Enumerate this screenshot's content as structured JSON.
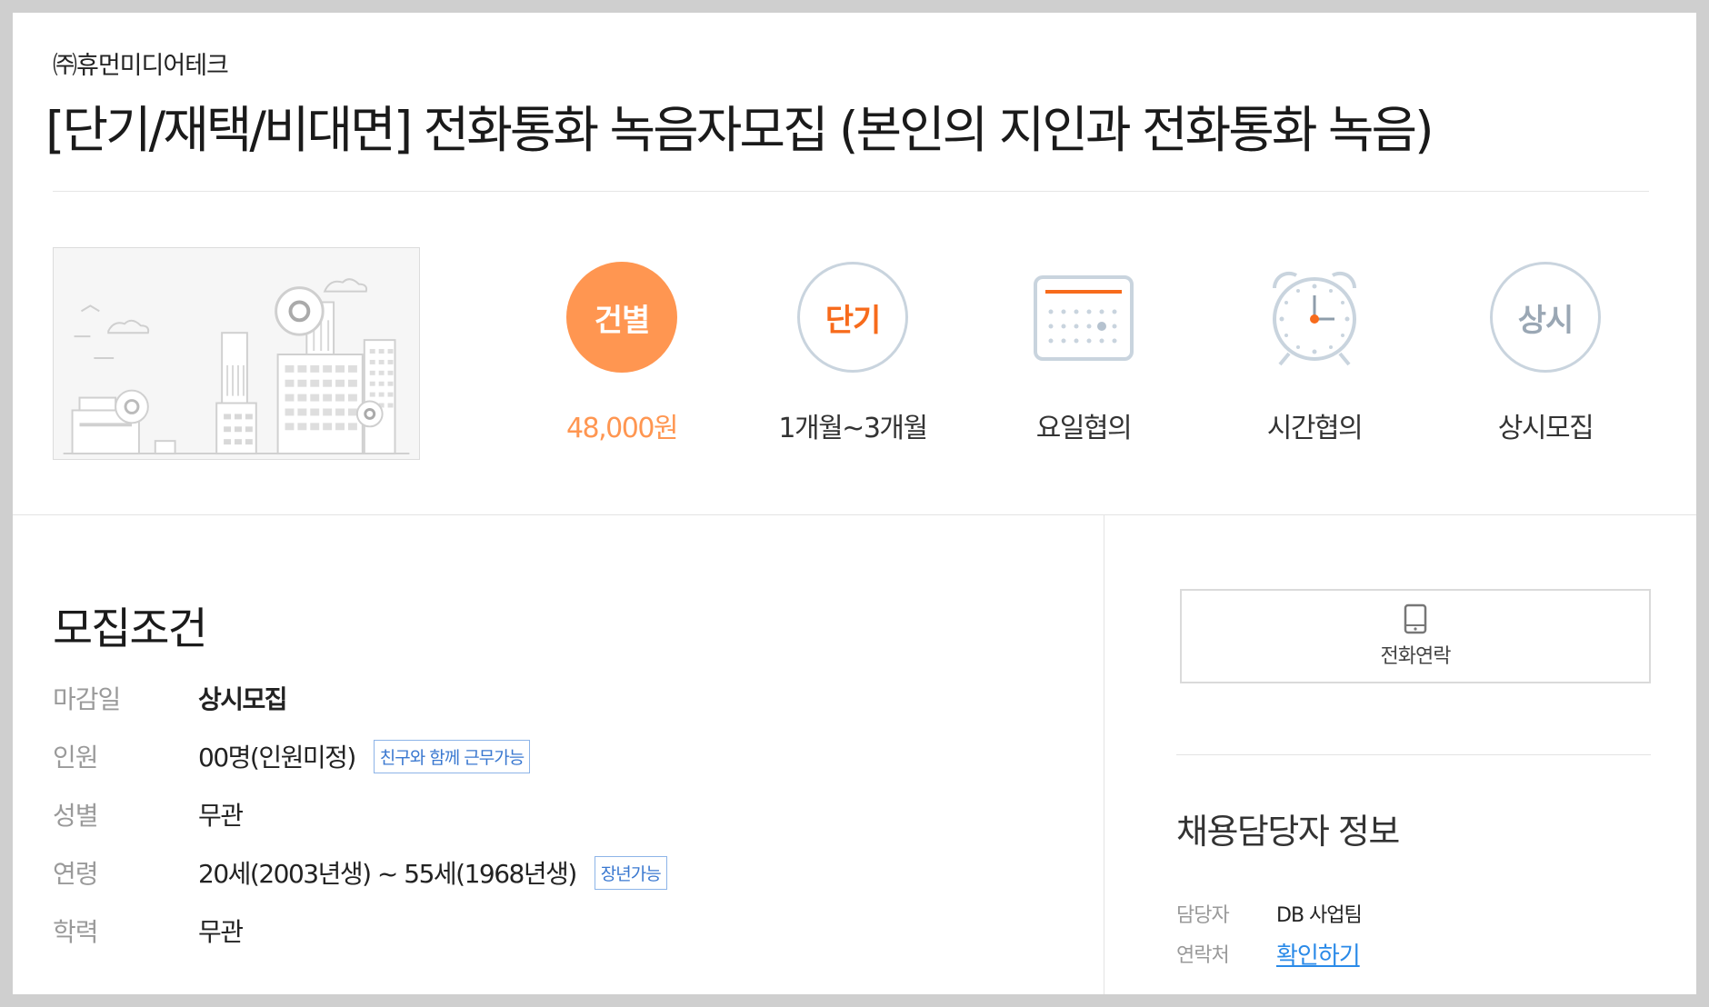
{
  "header": {
    "company": "㈜휴먼미디어테크",
    "title": "[단기/재택/비대면] 전화통화 녹음자모집 (본인의 지인과 전화통화 녹음)"
  },
  "summary": [
    {
      "circle_text": "건별",
      "label": "48,000원",
      "icon": "pay-type-circle"
    },
    {
      "circle_text": "단기",
      "label": "1개월~3개월",
      "icon": "period-circle"
    },
    {
      "circle_text": "",
      "label": "요일협의",
      "icon": "calendar-icon"
    },
    {
      "circle_text": "",
      "label": "시간협의",
      "icon": "alarm-clock-icon"
    },
    {
      "circle_text": "상시",
      "label": "상시모집",
      "icon": "deadline-circle"
    }
  ],
  "conditions": {
    "title": "모집조건",
    "rows": [
      {
        "key": "마감일",
        "value": "상시모집",
        "tag": ""
      },
      {
        "key": "인원",
        "value": "00명(인원미정)",
        "tag": "친구와 함께 근무가능"
      },
      {
        "key": "성별",
        "value": "무관",
        "tag": ""
      },
      {
        "key": "연령",
        "value": "20세(2003년생) ~ 55세(1968년생)",
        "tag": "장년가능"
      },
      {
        "key": "학력",
        "value": "무관",
        "tag": ""
      }
    ]
  },
  "side": {
    "call_label": "전화연락",
    "contact_title": "채용담당자 정보",
    "manager_key": "담당자",
    "manager_value": "DB 사업팀",
    "phone_key": "연락처",
    "phone_link": "확인하기"
  },
  "colors": {
    "accent_orange": "#ff9651",
    "text_orange": "#f76b1c",
    "tag_blue": "#3a78d0",
    "link_blue": "#2a8ae8"
  }
}
